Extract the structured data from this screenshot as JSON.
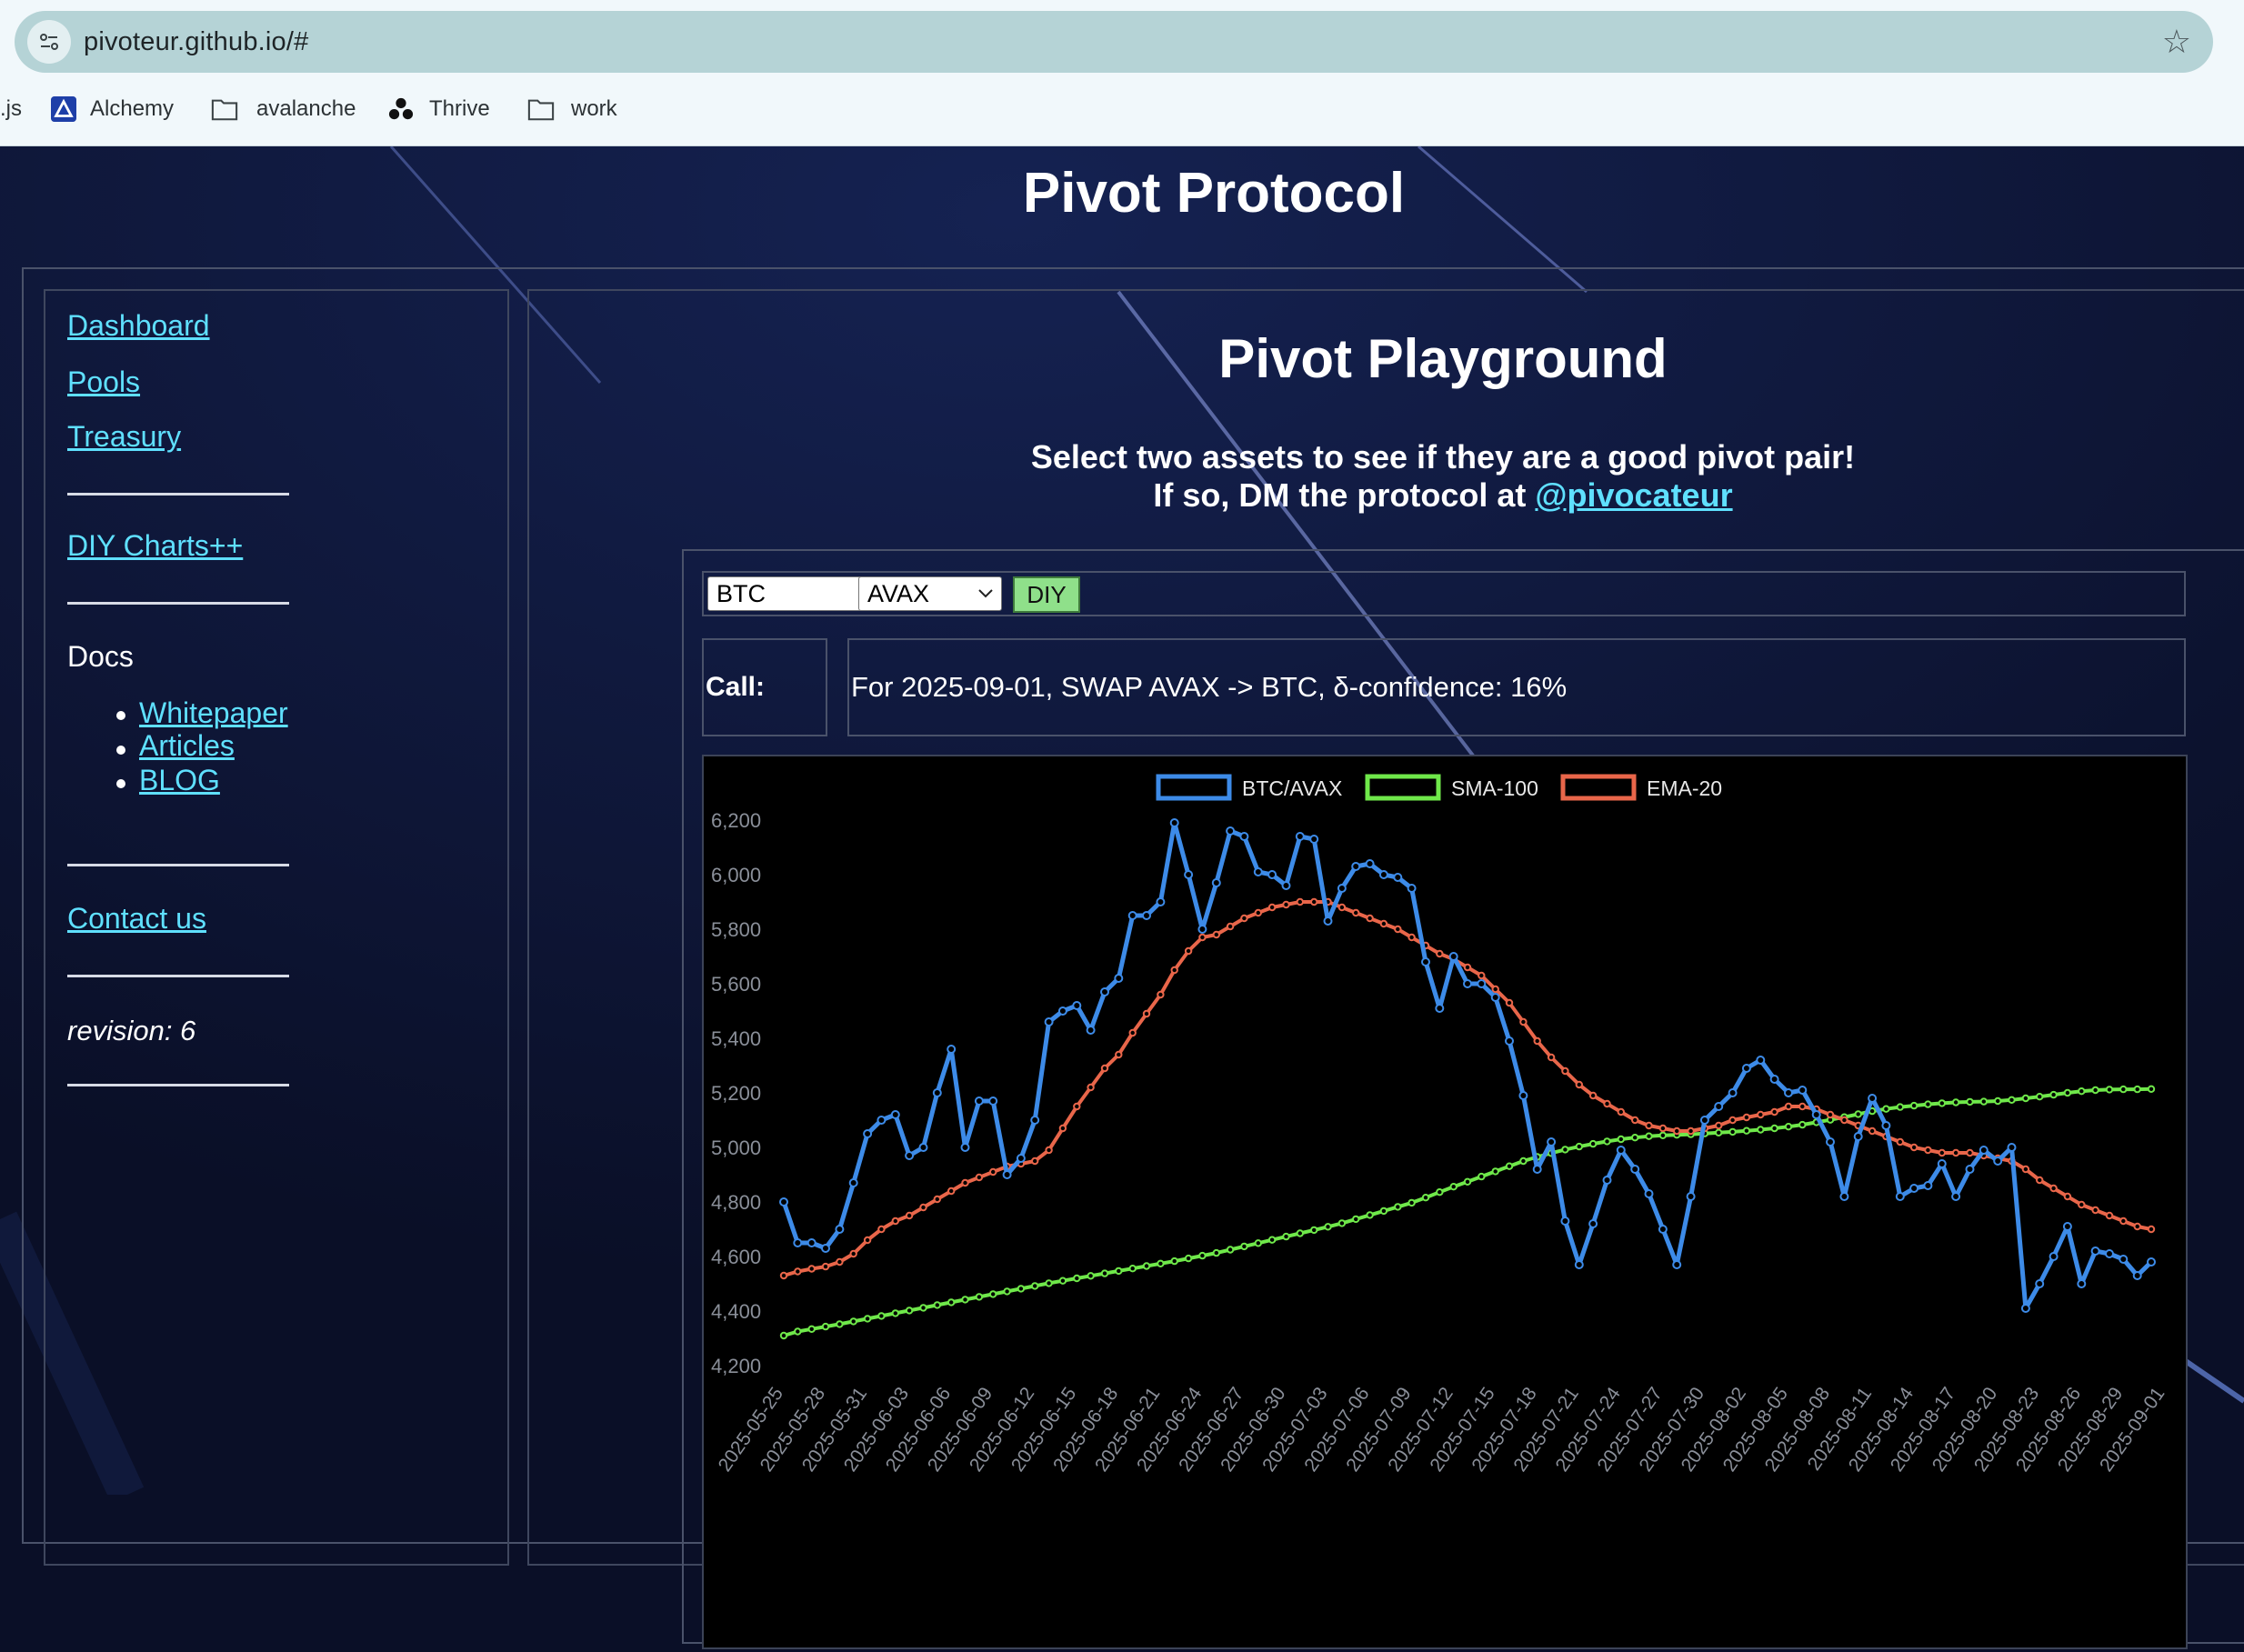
{
  "browser": {
    "url": "pivoteur.github.io/#",
    "bookmarks": [
      {
        "label": ".js",
        "icon": "none"
      },
      {
        "label": "Alchemy",
        "icon": "alchemy-logo-icon"
      },
      {
        "label": "avalanche",
        "icon": "folder-icon"
      },
      {
        "label": "Thrive",
        "icon": "thrive-logo-icon"
      },
      {
        "label": "work",
        "icon": "folder-icon"
      }
    ]
  },
  "site": {
    "title": "Pivot Protocol"
  },
  "sidebar": {
    "links": [
      "Dashboard",
      "Pools",
      "Treasury"
    ],
    "diy": "DIY Charts++",
    "docs_heading": "Docs",
    "docs_items": [
      "Whitepaper",
      "Articles",
      "BLOG"
    ],
    "contact": "Contact us",
    "revision": "revision: 6"
  },
  "main": {
    "title": "Pivot Playground",
    "subtitle_line1": "Select two assets to see if they are a good pivot pair!",
    "subtitle_line2_prefix": "If so, DM the protocol at",
    "handle": "@pivocateur",
    "select_a": "BTC",
    "select_b": "AVAX",
    "diy_button": "DIY",
    "call_label": "Call:",
    "call_text": "For 2025-09-01, SWAP AVAX -> BTC, δ-confidence: 16%"
  },
  "chart_data": {
    "type": "line",
    "title": "",
    "ylim": [
      4200,
      6300
    ],
    "y_ticks": [
      4200,
      4400,
      4600,
      4800,
      5000,
      5200,
      5400,
      5600,
      5800,
      6000,
      6200
    ],
    "y_tick_labels": [
      "4,200",
      "4,400",
      "4,600",
      "4,800",
      "5,000",
      "5,200",
      "5,400",
      "5,600",
      "5,800",
      "6,000",
      "6,200"
    ],
    "x_tick_labels": [
      "2025-05-25",
      "2025-05-28",
      "2025-05-31",
      "2025-06-03",
      "2025-06-06",
      "2025-06-09",
      "2025-06-12",
      "2025-06-15",
      "2025-06-18",
      "2025-06-21",
      "2025-06-24",
      "2025-06-27",
      "2025-06-30",
      "2025-07-03",
      "2025-07-06",
      "2025-07-09",
      "2025-07-12",
      "2025-07-15",
      "2025-07-18",
      "2025-07-21",
      "2025-07-24",
      "2025-07-27",
      "2025-07-30",
      "2025-08-02",
      "2025-08-05",
      "2025-08-08",
      "2025-08-11",
      "2025-08-14",
      "2025-08-17",
      "2025-08-20",
      "2025-08-23",
      "2025-08-26",
      "2025-08-29",
      "2025-09-01"
    ],
    "legend_position": "top-center",
    "colors": {
      "btc_avax": "#3d8be8",
      "sma": "#6fe84a",
      "ema": "#e9664a"
    },
    "series": [
      {
        "name": "BTC/AVAX",
        "values": [
          4800,
          4650,
          4650,
          4630,
          4700,
          4870,
          5050,
          5100,
          5120,
          4970,
          5000,
          5200,
          5360,
          5000,
          5170,
          5170,
          4900,
          4960,
          5100,
          5460,
          5500,
          5520,
          5430,
          5570,
          5620,
          5850,
          5850,
          5900,
          6190,
          6000,
          5800,
          5970,
          6160,
          6140,
          6010,
          6000,
          5960,
          6140,
          6130,
          5830,
          5950,
          6030,
          6040,
          6000,
          5990,
          5950,
          5680,
          5510,
          5700,
          5600,
          5600,
          5550,
          5390,
          5190,
          4920,
          5020,
          4730,
          4570,
          4720,
          4880,
          4990,
          4920,
          4830,
          4700,
          4570,
          4820,
          5100,
          5150,
          5200,
          5290,
          5320,
          5250,
          5200,
          5210,
          5120,
          5020,
          4820,
          5040,
          5180,
          5080,
          4820,
          4850,
          4860,
          4940,
          4820,
          4920,
          4990,
          4950,
          5000,
          4410,
          4500,
          4600,
          4710,
          4500,
          4620,
          4610,
          4590,
          4530,
          4580
        ]
      },
      {
        "name": "SMA-100",
        "values": [
          4310,
          4325,
          4334,
          4343,
          4352,
          4362,
          4372,
          4382,
          4392,
          4402,
          4412,
          4422,
          4432,
          4442,
          4452,
          4462,
          4472,
          4482,
          4492,
          4502,
          4511,
          4520,
          4529,
          4538,
          4547,
          4556,
          4565,
          4574,
          4583,
          4593,
          4603,
          4613,
          4625,
          4637,
          4649,
          4661,
          4673,
          4685,
          4697,
          4709,
          4722,
          4737,
          4752,
          4767,
          4782,
          4797,
          4816,
          4836,
          4856,
          4874,
          4893,
          4912,
          4931,
          4950,
          4965,
          4979,
          4992,
          5003,
          5013,
          5022,
          5030,
          5036,
          5041,
          5044,
          5046,
          5048,
          5051,
          5054,
          5057,
          5061,
          5065,
          5070,
          5076,
          5083,
          5092,
          5101,
          5111,
          5122,
          5133,
          5141,
          5148,
          5153,
          5158,
          5162,
          5165,
          5167,
          5168,
          5170,
          5174,
          5180,
          5186,
          5193,
          5200,
          5206,
          5210,
          5212,
          5213,
          5213,
          5214
        ]
      },
      {
        "name": "EMA-20",
        "values": [
          4530,
          4545,
          4555,
          4563,
          4580,
          4610,
          4660,
          4700,
          4730,
          4750,
          4780,
          4810,
          4840,
          4870,
          4890,
          4910,
          4930,
          4940,
          4950,
          4990,
          5070,
          5150,
          5220,
          5290,
          5340,
          5420,
          5490,
          5560,
          5650,
          5720,
          5770,
          5780,
          5810,
          5840,
          5860,
          5880,
          5890,
          5900,
          5900,
          5900,
          5880,
          5860,
          5840,
          5820,
          5800,
          5770,
          5740,
          5710,
          5690,
          5660,
          5630,
          5580,
          5530,
          5460,
          5390,
          5330,
          5280,
          5230,
          5190,
          5160,
          5130,
          5100,
          5080,
          5070,
          5060,
          5060,
          5070,
          5080,
          5100,
          5110,
          5120,
          5130,
          5150,
          5150,
          5140,
          5120,
          5100,
          5080,
          5060,
          5040,
          5020,
          5000,
          4990,
          4980,
          4980,
          4980,
          4970,
          4960,
          4950,
          4920,
          4880,
          4850,
          4820,
          4790,
          4770,
          4750,
          4730,
          4710,
          4700
        ]
      }
    ]
  }
}
